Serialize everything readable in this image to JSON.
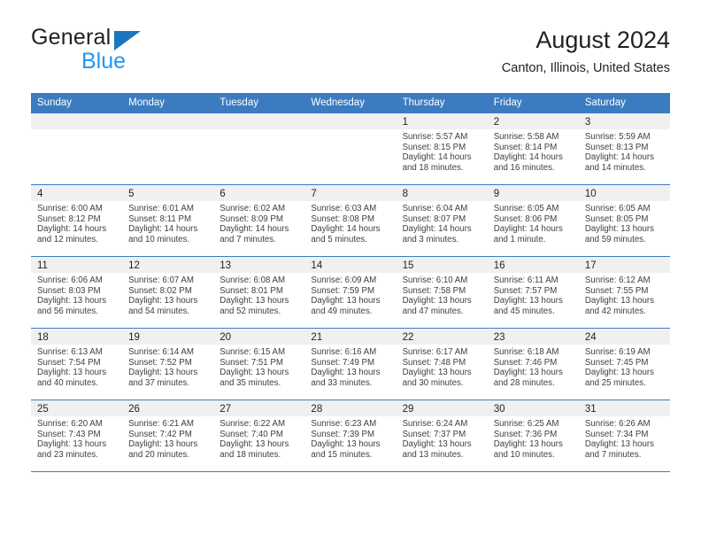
{
  "brand": {
    "name_top": "General",
    "name_bottom": "Blue",
    "triangle_color": "#1b76bd",
    "blue_text_color": "#2196f3"
  },
  "header": {
    "title": "August 2024",
    "location": "Canton, Illinois, United States"
  },
  "theme": {
    "header_blue": "#3b7cc0",
    "day_band_gray": "#f0f0f0",
    "text_color": "#231f20",
    "info_text_color": "#404040"
  },
  "weekday_headers": [
    "Sunday",
    "Monday",
    "Tuesday",
    "Wednesday",
    "Thursday",
    "Friday",
    "Saturday"
  ],
  "weeks": [
    [
      {
        "day": "",
        "sunrise": "",
        "sunset": "",
        "daylight1": "",
        "daylight2": ""
      },
      {
        "day": "",
        "sunrise": "",
        "sunset": "",
        "daylight1": "",
        "daylight2": ""
      },
      {
        "day": "",
        "sunrise": "",
        "sunset": "",
        "daylight1": "",
        "daylight2": ""
      },
      {
        "day": "",
        "sunrise": "",
        "sunset": "",
        "daylight1": "",
        "daylight2": ""
      },
      {
        "day": "1",
        "sunrise": "Sunrise: 5:57 AM",
        "sunset": "Sunset: 8:15 PM",
        "daylight1": "Daylight: 14 hours",
        "daylight2": "and 18 minutes."
      },
      {
        "day": "2",
        "sunrise": "Sunrise: 5:58 AM",
        "sunset": "Sunset: 8:14 PM",
        "daylight1": "Daylight: 14 hours",
        "daylight2": "and 16 minutes."
      },
      {
        "day": "3",
        "sunrise": "Sunrise: 5:59 AM",
        "sunset": "Sunset: 8:13 PM",
        "daylight1": "Daylight: 14 hours",
        "daylight2": "and 14 minutes."
      }
    ],
    [
      {
        "day": "4",
        "sunrise": "Sunrise: 6:00 AM",
        "sunset": "Sunset: 8:12 PM",
        "daylight1": "Daylight: 14 hours",
        "daylight2": "and 12 minutes."
      },
      {
        "day": "5",
        "sunrise": "Sunrise: 6:01 AM",
        "sunset": "Sunset: 8:11 PM",
        "daylight1": "Daylight: 14 hours",
        "daylight2": "and 10 minutes."
      },
      {
        "day": "6",
        "sunrise": "Sunrise: 6:02 AM",
        "sunset": "Sunset: 8:09 PM",
        "daylight1": "Daylight: 14 hours",
        "daylight2": "and 7 minutes."
      },
      {
        "day": "7",
        "sunrise": "Sunrise: 6:03 AM",
        "sunset": "Sunset: 8:08 PM",
        "daylight1": "Daylight: 14 hours",
        "daylight2": "and 5 minutes."
      },
      {
        "day": "8",
        "sunrise": "Sunrise: 6:04 AM",
        "sunset": "Sunset: 8:07 PM",
        "daylight1": "Daylight: 14 hours",
        "daylight2": "and 3 minutes."
      },
      {
        "day": "9",
        "sunrise": "Sunrise: 6:05 AM",
        "sunset": "Sunset: 8:06 PM",
        "daylight1": "Daylight: 14 hours",
        "daylight2": "and 1 minute."
      },
      {
        "day": "10",
        "sunrise": "Sunrise: 6:05 AM",
        "sunset": "Sunset: 8:05 PM",
        "daylight1": "Daylight: 13 hours",
        "daylight2": "and 59 minutes."
      }
    ],
    [
      {
        "day": "11",
        "sunrise": "Sunrise: 6:06 AM",
        "sunset": "Sunset: 8:03 PM",
        "daylight1": "Daylight: 13 hours",
        "daylight2": "and 56 minutes."
      },
      {
        "day": "12",
        "sunrise": "Sunrise: 6:07 AM",
        "sunset": "Sunset: 8:02 PM",
        "daylight1": "Daylight: 13 hours",
        "daylight2": "and 54 minutes."
      },
      {
        "day": "13",
        "sunrise": "Sunrise: 6:08 AM",
        "sunset": "Sunset: 8:01 PM",
        "daylight1": "Daylight: 13 hours",
        "daylight2": "and 52 minutes."
      },
      {
        "day": "14",
        "sunrise": "Sunrise: 6:09 AM",
        "sunset": "Sunset: 7:59 PM",
        "daylight1": "Daylight: 13 hours",
        "daylight2": "and 49 minutes."
      },
      {
        "day": "15",
        "sunrise": "Sunrise: 6:10 AM",
        "sunset": "Sunset: 7:58 PM",
        "daylight1": "Daylight: 13 hours",
        "daylight2": "and 47 minutes."
      },
      {
        "day": "16",
        "sunrise": "Sunrise: 6:11 AM",
        "sunset": "Sunset: 7:57 PM",
        "daylight1": "Daylight: 13 hours",
        "daylight2": "and 45 minutes."
      },
      {
        "day": "17",
        "sunrise": "Sunrise: 6:12 AM",
        "sunset": "Sunset: 7:55 PM",
        "daylight1": "Daylight: 13 hours",
        "daylight2": "and 42 minutes."
      }
    ],
    [
      {
        "day": "18",
        "sunrise": "Sunrise: 6:13 AM",
        "sunset": "Sunset: 7:54 PM",
        "daylight1": "Daylight: 13 hours",
        "daylight2": "and 40 minutes."
      },
      {
        "day": "19",
        "sunrise": "Sunrise: 6:14 AM",
        "sunset": "Sunset: 7:52 PM",
        "daylight1": "Daylight: 13 hours",
        "daylight2": "and 37 minutes."
      },
      {
        "day": "20",
        "sunrise": "Sunrise: 6:15 AM",
        "sunset": "Sunset: 7:51 PM",
        "daylight1": "Daylight: 13 hours",
        "daylight2": "and 35 minutes."
      },
      {
        "day": "21",
        "sunrise": "Sunrise: 6:16 AM",
        "sunset": "Sunset: 7:49 PM",
        "daylight1": "Daylight: 13 hours",
        "daylight2": "and 33 minutes."
      },
      {
        "day": "22",
        "sunrise": "Sunrise: 6:17 AM",
        "sunset": "Sunset: 7:48 PM",
        "daylight1": "Daylight: 13 hours",
        "daylight2": "and 30 minutes."
      },
      {
        "day": "23",
        "sunrise": "Sunrise: 6:18 AM",
        "sunset": "Sunset: 7:46 PM",
        "daylight1": "Daylight: 13 hours",
        "daylight2": "and 28 minutes."
      },
      {
        "day": "24",
        "sunrise": "Sunrise: 6:19 AM",
        "sunset": "Sunset: 7:45 PM",
        "daylight1": "Daylight: 13 hours",
        "daylight2": "and 25 minutes."
      }
    ],
    [
      {
        "day": "25",
        "sunrise": "Sunrise: 6:20 AM",
        "sunset": "Sunset: 7:43 PM",
        "daylight1": "Daylight: 13 hours",
        "daylight2": "and 23 minutes."
      },
      {
        "day": "26",
        "sunrise": "Sunrise: 6:21 AM",
        "sunset": "Sunset: 7:42 PM",
        "daylight1": "Daylight: 13 hours",
        "daylight2": "and 20 minutes."
      },
      {
        "day": "27",
        "sunrise": "Sunrise: 6:22 AM",
        "sunset": "Sunset: 7:40 PM",
        "daylight1": "Daylight: 13 hours",
        "daylight2": "and 18 minutes."
      },
      {
        "day": "28",
        "sunrise": "Sunrise: 6:23 AM",
        "sunset": "Sunset: 7:39 PM",
        "daylight1": "Daylight: 13 hours",
        "daylight2": "and 15 minutes."
      },
      {
        "day": "29",
        "sunrise": "Sunrise: 6:24 AM",
        "sunset": "Sunset: 7:37 PM",
        "daylight1": "Daylight: 13 hours",
        "daylight2": "and 13 minutes."
      },
      {
        "day": "30",
        "sunrise": "Sunrise: 6:25 AM",
        "sunset": "Sunset: 7:36 PM",
        "daylight1": "Daylight: 13 hours",
        "daylight2": "and 10 minutes."
      },
      {
        "day": "31",
        "sunrise": "Sunrise: 6:26 AM",
        "sunset": "Sunset: 7:34 PM",
        "daylight1": "Daylight: 13 hours",
        "daylight2": "and 7 minutes."
      }
    ]
  ]
}
